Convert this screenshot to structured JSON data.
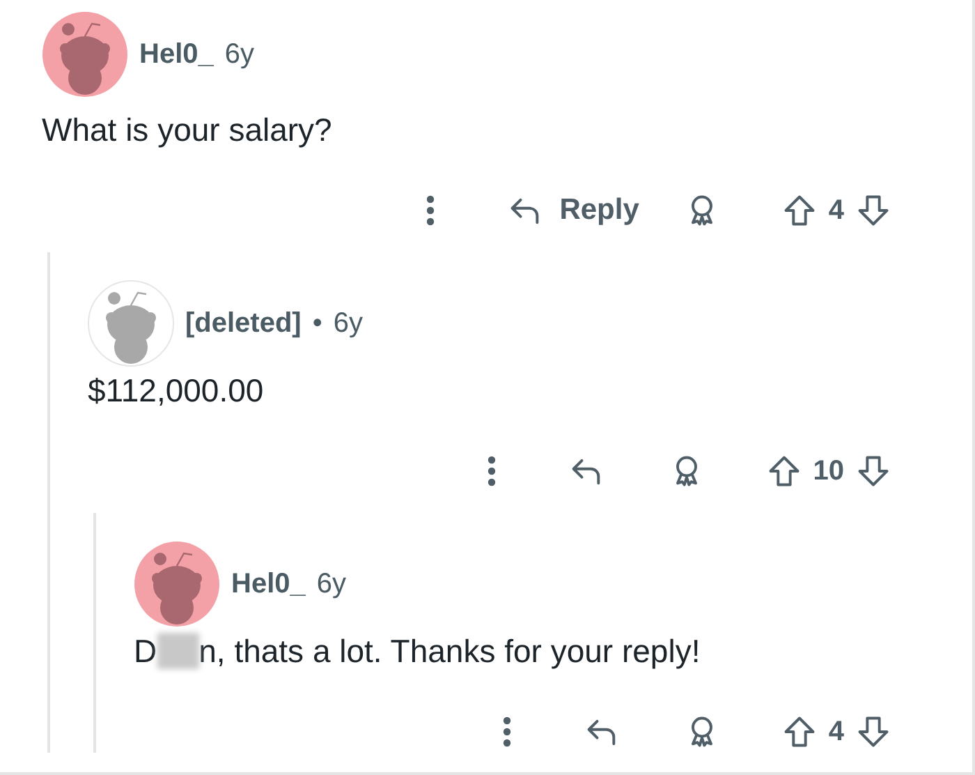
{
  "comments": [
    {
      "avatar": {
        "kind": "pink"
      },
      "author": "Hel0_",
      "time": "6y",
      "body": [
        {
          "kind": "text",
          "text": "What is your salary?"
        }
      ],
      "actions": {
        "reply_label": "Reply",
        "votes": "4"
      },
      "children": [
        {
          "avatar": {
            "kind": "default"
          },
          "author": "[deleted]",
          "separator": "•",
          "time": "6y",
          "body": [
            {
              "kind": "text",
              "text": "$112,000.00"
            }
          ],
          "actions": {
            "votes": "10"
          },
          "children": [
            {
              "avatar": {
                "kind": "pink"
              },
              "author": "Hel0_",
              "time": "6y",
              "body": [
                {
                  "kind": "text",
                  "text": "D"
                },
                {
                  "kind": "blur"
                },
                {
                  "kind": "text",
                  "text": "n, thats a lot. Thanks for your reply!"
                }
              ],
              "actions": {
                "votes": "4"
              }
            }
          ]
        }
      ]
    }
  ]
}
